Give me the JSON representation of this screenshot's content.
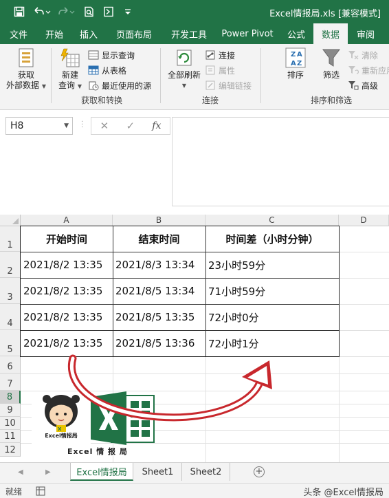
{
  "window": {
    "title": "Excel情报局.xls  [兼容模式]"
  },
  "quick_access": [
    "save-icon",
    "undo-icon",
    "redo-icon",
    "print-preview-icon",
    "document-icon",
    "customize-icon"
  ],
  "tabs": [
    {
      "label": "文件",
      "active": false
    },
    {
      "label": "开始",
      "active": false
    },
    {
      "label": "插入",
      "active": false
    },
    {
      "label": "页面布局",
      "active": false
    },
    {
      "label": "开发工具",
      "active": false
    },
    {
      "label": "Power Pivot",
      "active": false
    },
    {
      "label": "公式",
      "active": false
    },
    {
      "label": "数据",
      "active": true
    },
    {
      "label": "审阅",
      "active": false
    }
  ],
  "ribbon": {
    "get_external": {
      "line1": "获取",
      "line2": "外部数据"
    },
    "new_query": {
      "line1": "新建",
      "line2": "查询"
    },
    "show_queries": "显示查询",
    "from_table": "从表格",
    "recent_sources": "最近使用的源",
    "group_get_transform": "获取和转换",
    "refresh_all": "全部刷新",
    "connections": "连接",
    "properties": "属性",
    "edit_links": "编辑链接",
    "group_connections": "连接",
    "sort": "排序",
    "filter": "筛选",
    "clear": "清除",
    "reapply": "重新应用",
    "advanced": "高级",
    "group_sort_filter": "排序和筛选"
  },
  "formula_bar": {
    "name_box": "H8",
    "cancel": "✕",
    "enter": "✓",
    "fx": "fx"
  },
  "columns": [
    "A",
    "B",
    "C",
    "D"
  ],
  "rows": [
    "1",
    "2",
    "3",
    "4",
    "5",
    "6",
    "7",
    "8",
    "9",
    "10",
    "11",
    "12"
  ],
  "selected_row": "8",
  "table": {
    "headers": [
      "开始时间",
      "结束时间",
      "时间差（小时分钟）"
    ],
    "data": [
      [
        "2021/8/2 13:35",
        "2021/8/3 13:34",
        "23小时59分"
      ],
      [
        "2021/8/2 13:35",
        "2021/8/5 13:34",
        "71小时59分"
      ],
      [
        "2021/8/2 13:35",
        "2021/8/5 13:35",
        "72小时0分"
      ],
      [
        "2021/8/2 13:35",
        "2021/8/5 13:36",
        "72小时1分"
      ]
    ]
  },
  "sheets": [
    {
      "label": "Excel情报局",
      "active": true
    },
    {
      "label": "Sheet1",
      "active": false
    },
    {
      "label": "Sheet2",
      "active": false
    }
  ],
  "status": {
    "ready": "就绪",
    "watermark": "头条 @Excel情报局"
  },
  "logo": {
    "mascot_label": "Excel情报局",
    "caption": "Excel 情 报 局"
  },
  "colors": {
    "accent": "#217346",
    "arrow": "#c8282d"
  }
}
